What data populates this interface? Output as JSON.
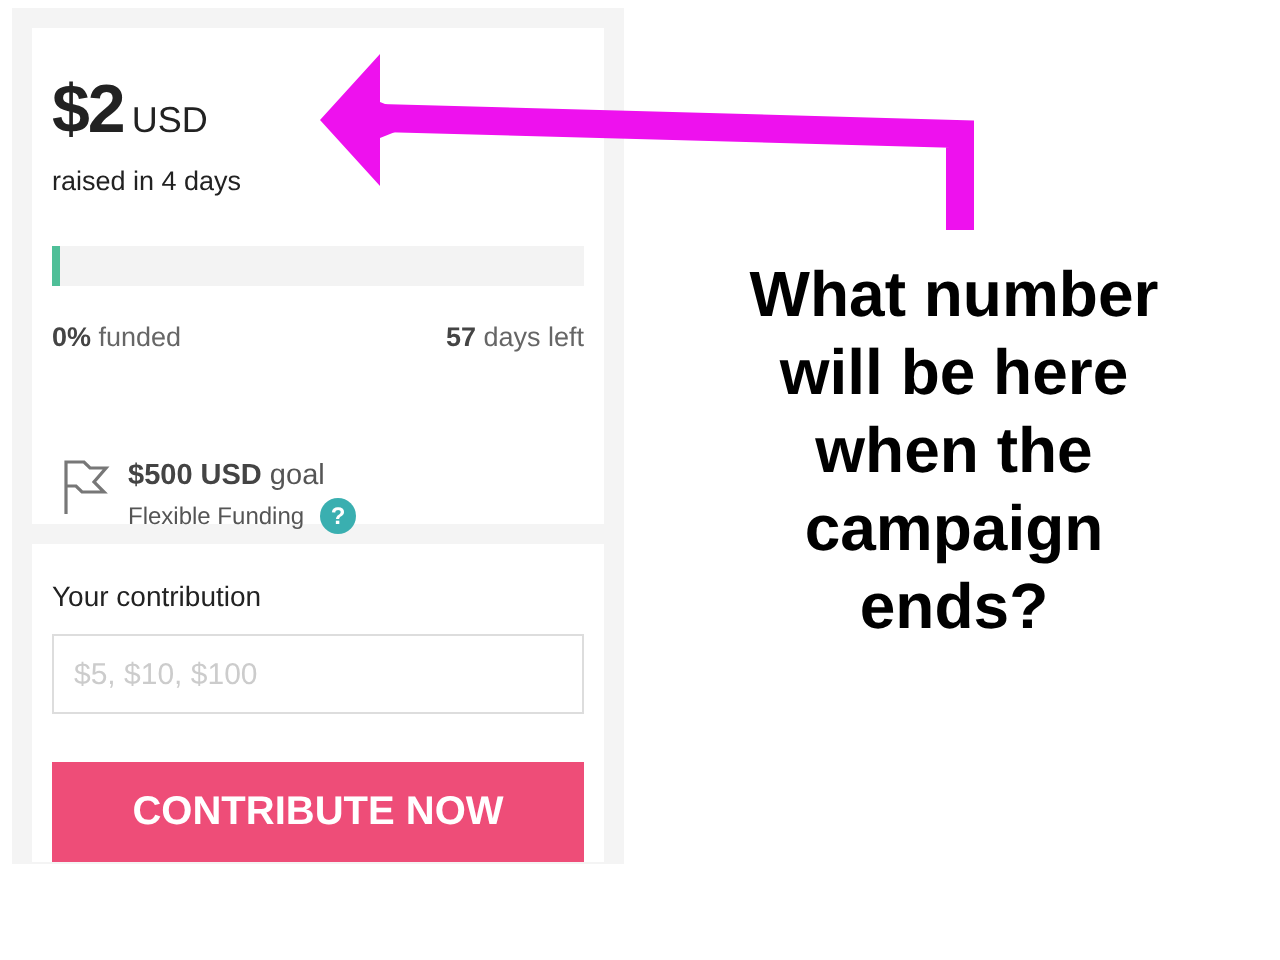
{
  "summary": {
    "amount": "$2",
    "currency": "USD",
    "raised_in": "raised in 4 days",
    "progress": {
      "level": 0.015
    },
    "funded_pct": "0%",
    "funded_label": "funded",
    "days_num": "57",
    "days_label": "days left",
    "goal_amount": "$500 USD",
    "goal_label": "goal",
    "funding_type": "Flexible Funding",
    "help": "?"
  },
  "contribution": {
    "label": "Your contribution",
    "placeholder": "$5, $10, $100",
    "button": "CONTRIBUTE NOW"
  },
  "annotation": {
    "lines": [
      "What number",
      "will be here",
      "when the",
      "campaign",
      "ends?"
    ]
  }
}
